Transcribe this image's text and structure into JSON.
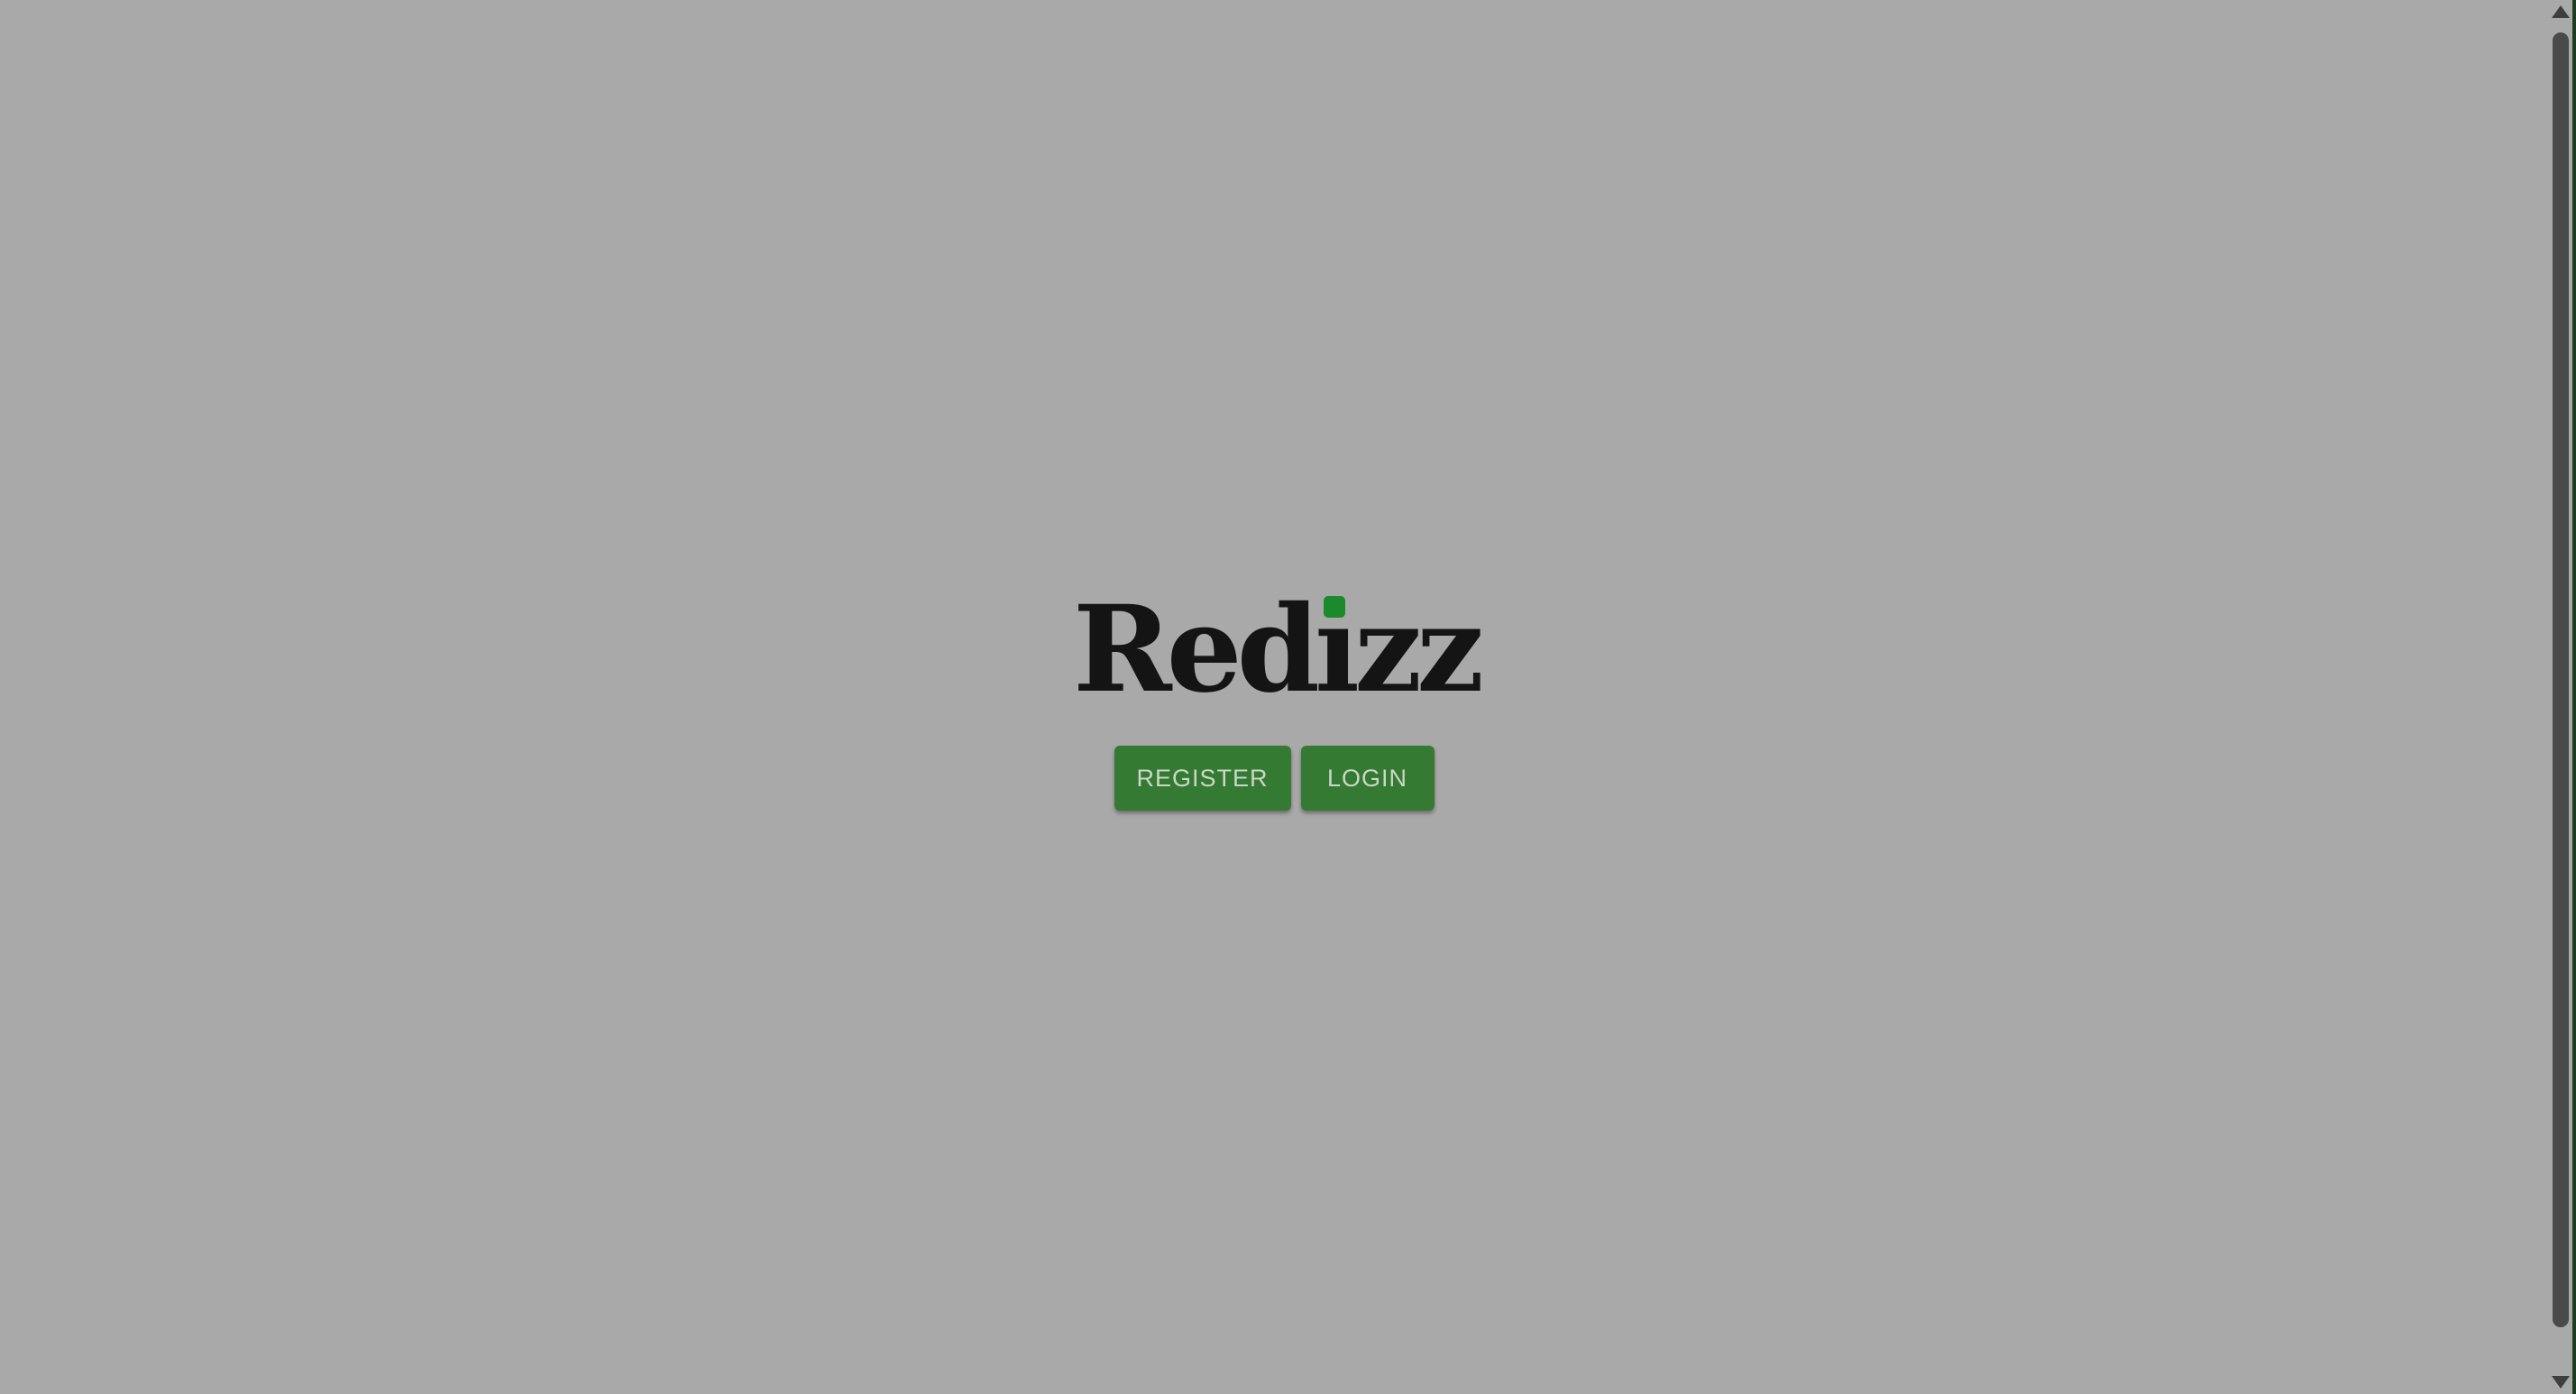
{
  "brand": {
    "logo_text_before": "Red",
    "logo_i": "ı",
    "logo_text_after": "zz",
    "logo_full": "Redizz",
    "logo_dot_color": "#1a8a2c"
  },
  "actions": {
    "register_label": "REGISTER",
    "login_label": "LOGIN",
    "button_color": "#357a32"
  },
  "icons": {
    "scroll_up": "scroll-up-arrow-icon",
    "scroll_down": "scroll-down-arrow-icon"
  }
}
